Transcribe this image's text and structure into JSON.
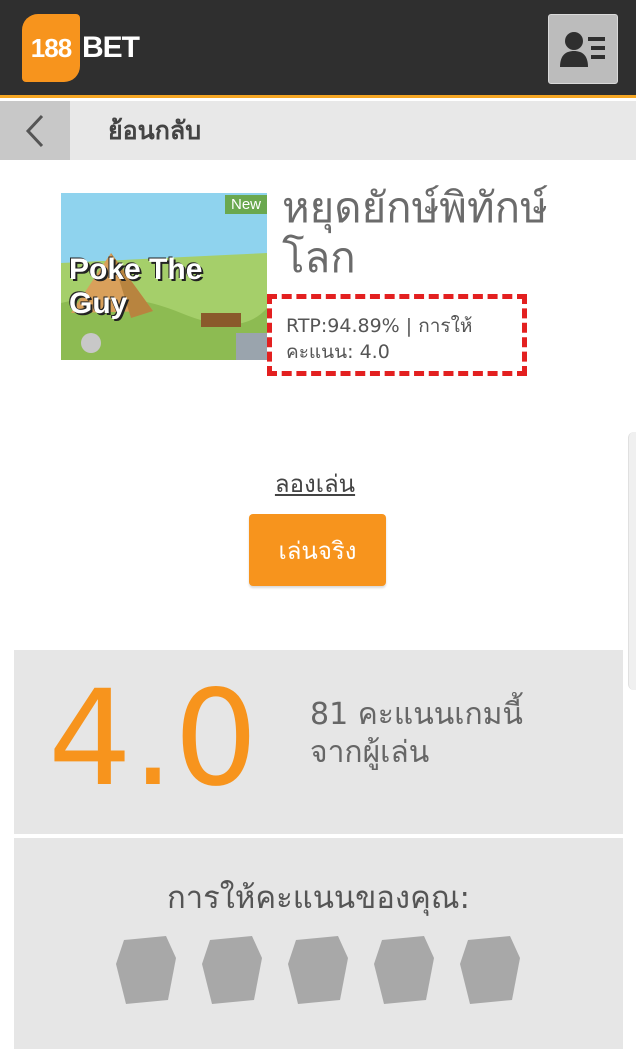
{
  "header": {
    "logo_number": "188",
    "logo_text": "BET",
    "account_icon": "user-menu-icon"
  },
  "nav": {
    "back_icon": "chevron-left-icon",
    "back_label": "ย้อนกลับ"
  },
  "game": {
    "badge": "New",
    "thumbnail_title": "Poke The Guy",
    "title": "หยุดยักษ์พิทักษ์โลก",
    "rtp_text": "RTP:94.89% | การให้คะแนน: 4.0",
    "demo_label": "ลองเล่น",
    "play_label": "เล่นจริง"
  },
  "rating": {
    "score": "4.0",
    "description": "81 คะแนนเกมนี้จากผู้เล่น"
  },
  "your_rating": {
    "label": "การให้คะแนนของคุณ:",
    "stars": [
      {
        "name": "rating-star-1-icon"
      },
      {
        "name": "rating-star-2-icon"
      },
      {
        "name": "rating-star-3-icon"
      },
      {
        "name": "rating-star-4-icon"
      },
      {
        "name": "rating-star-5-icon"
      }
    ]
  },
  "colors": {
    "brand_orange": "#f7941d",
    "header_dark": "#2f2f2f",
    "highlight_red": "#e32020",
    "panel_gray": "#e6e6e6"
  }
}
